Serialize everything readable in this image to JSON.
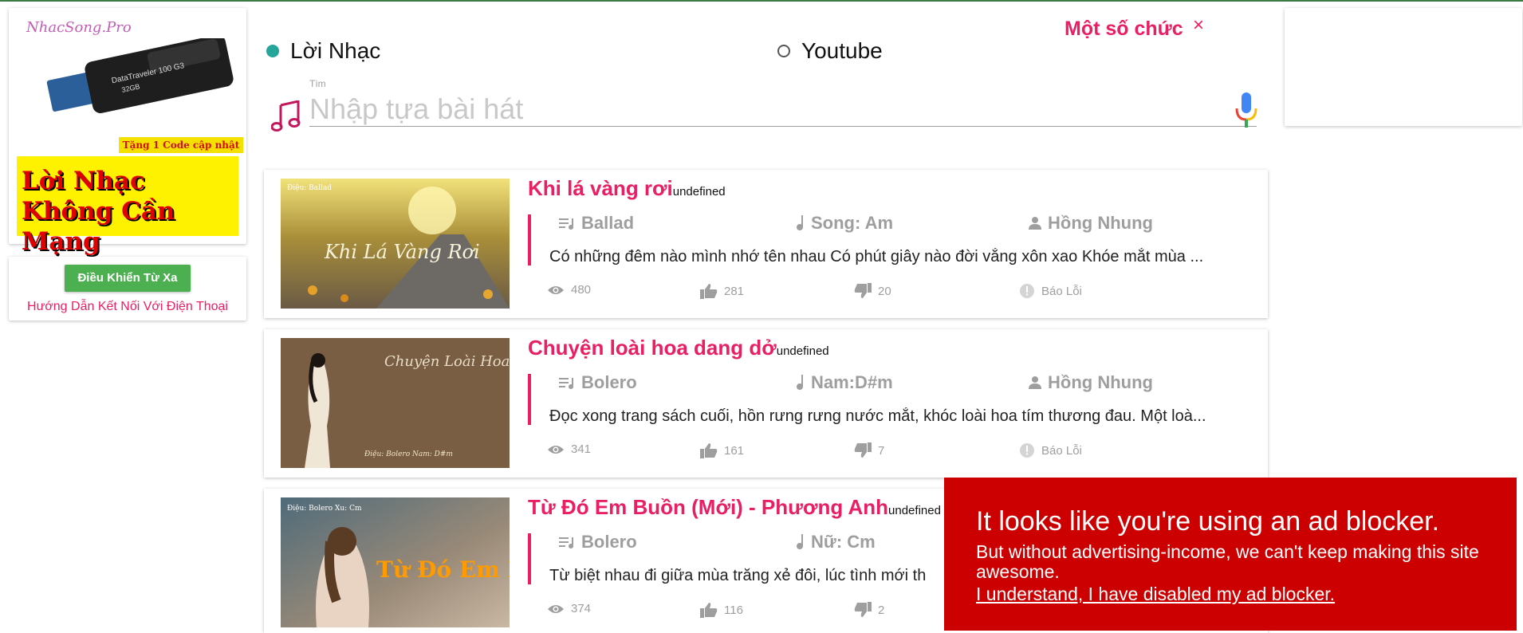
{
  "left_ad": {
    "logo_text": "NhacSong.Pro",
    "gift_text": "Tặng 1 Code cập nhật",
    "banner_text": "Lời Nhạc Không Cần Mạng",
    "usb_brand": "DataTraveler 100 G3",
    "usb_capacity": "32GB"
  },
  "remote": {
    "button_label": "Điều Khiển Từ Xa",
    "link_label": "Hướng Dẫn Kết Nối Với Điện Thoại"
  },
  "search": {
    "mode_lyrics": "Lời Nhạc",
    "mode_youtube": "Youtube",
    "selected_mode": "Lời Nhạc",
    "label": "Tìm",
    "placeholder": "Nhập tựa bài hát",
    "value": ""
  },
  "tip": {
    "text": "Một số chức",
    "close": "×"
  },
  "songs": [
    {
      "title": "Khi lá vàng rơi",
      "suffix": "undefined",
      "genre": "Ballad",
      "key": "Song: Am",
      "singer": "Hồng Nhung",
      "lyrics": "Có những đêm nào mình nhớ tên nhau Có phút giây nào đời vắng xôn xao Khóe mắt mùa ...",
      "views": "480",
      "likes": "281",
      "dislikes": "20",
      "report": "Báo Lỗi",
      "thumb_text": "Khi Lá Vàng Rơi",
      "thumb_note": "Điệu: Ballad"
    },
    {
      "title": "Chuyện loài hoa dang dở",
      "suffix": "undefined",
      "genre": "Bolero",
      "key": "Nam:D#m",
      "singer": "Hồng Nhung",
      "lyrics": "Đọc xong trang sách cuối, hồn rưng rưng nước mắt, khóc loài hoa tím thương đau. Một loà...",
      "views": "341",
      "likes": "161",
      "dislikes": "7",
      "report": "Báo Lỗi",
      "thumb_text": "Chuyện Loài Hoa Dang Dở",
      "thumb_note": "Điệu: Bolero Nam: D#m"
    },
    {
      "title": "Từ Đó Em Buồn (Mới) - Phương Anh",
      "suffix": "undefined",
      "genre": "Bolero",
      "key": "Nữ: Cm",
      "singer": "",
      "lyrics": "Từ biệt nhau đi giữa mùa trăng xẻ đôi, lúc tình mới th",
      "views": "374",
      "likes": "116",
      "dislikes": "2",
      "report": "",
      "thumb_text": "Từ Đó Em Buồn",
      "thumb_note": "Điệu: Bolero Xu: Cm"
    }
  ],
  "adblock": {
    "title": "It looks like you're using an ad blocker.",
    "text": "But without advertising-income, we can't keep making this site awesome.",
    "link": "I understand, I have disabled my ad blocker."
  },
  "colors": {
    "accent": "#e91e63",
    "teal": "#26a69a",
    "green_button": "#4caf50",
    "adblock_bg": "#cc0000",
    "meta_gray": "#9e9e9e"
  }
}
